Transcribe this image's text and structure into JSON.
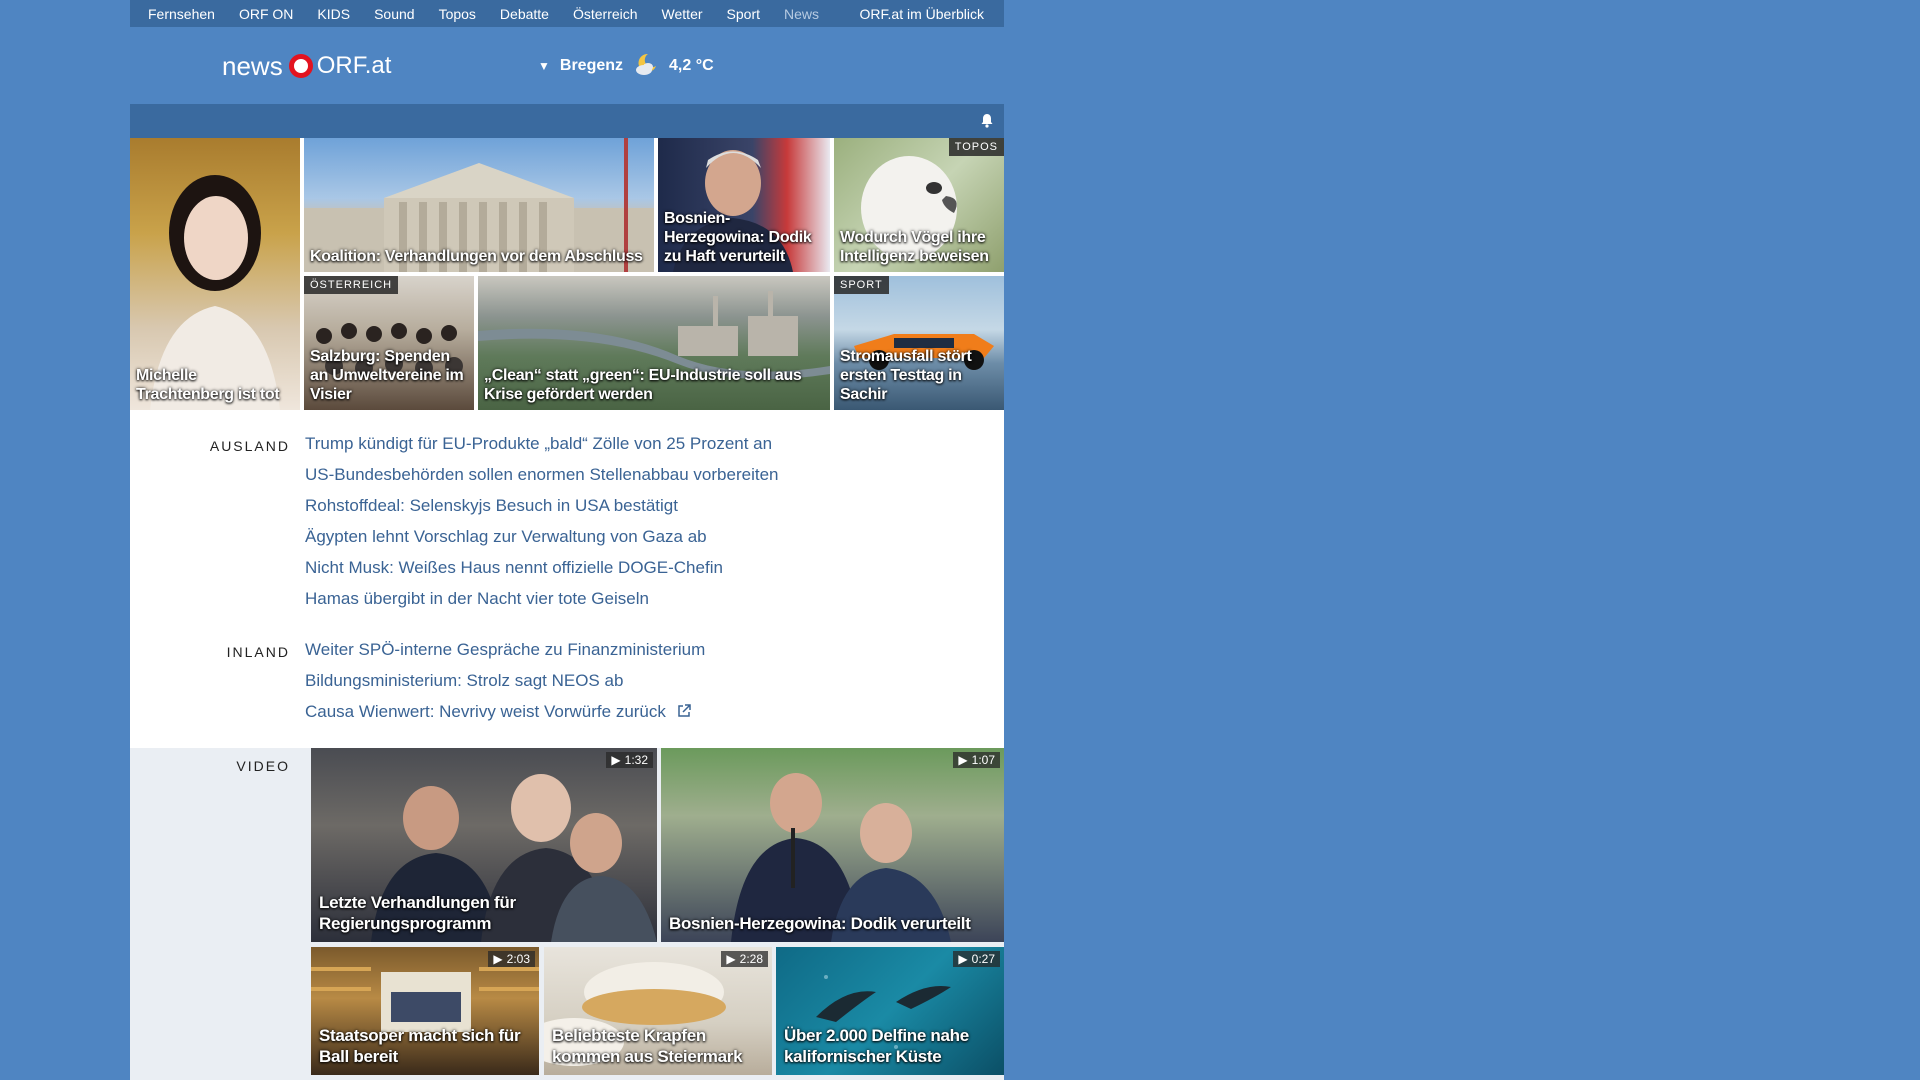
{
  "nav": {
    "items": [
      "Fernsehen",
      "ORF ON",
      "KIDS",
      "Sound",
      "Topos",
      "Debatte",
      "Österreich",
      "Wetter",
      "Sport",
      "News"
    ],
    "active": "News",
    "overview": "ORF.at im Überblick"
  },
  "header": {
    "logo_news": "news",
    "logo_orf": "ORF.at",
    "weather_city": "Bregenz",
    "weather_temp": "4,2 °C",
    "weather_icon": "partly-cloudy-moon-icon"
  },
  "top_stories": [
    {
      "caption": "Michelle Trachtenberg ist tot",
      "tag": ""
    },
    {
      "caption": "Koalition: Verhandlungen vor dem Abschluss",
      "tag": ""
    },
    {
      "caption": "Bosnien-Herzegowina: Dodik zu Haft verurteilt",
      "tag": ""
    },
    {
      "caption": "Wodurch Vögel ihre Intelligenz beweisen",
      "tag": "TOPOS"
    },
    {
      "caption": "Salzburg: Spenden an Umweltvereine im Visier",
      "tag": "ÖSTERREICH"
    },
    {
      "caption": "„Clean“ statt „green“: EU-Industrie soll aus Krise gefördert werden",
      "tag": ""
    },
    {
      "caption": "Stromausfall stört ersten Testtag in Sachir",
      "tag": "SPORT"
    }
  ],
  "ausland": {
    "label": "AUSLAND",
    "items": [
      "Trump kündigt für EU-Produkte „bald“ Zölle von 25 Prozent an",
      "US-Bundesbehörden sollen enormen Stellenabbau vorbereiten",
      "Rohstoffdeal: Selenskyjs Besuch in USA bestätigt",
      "Ägypten lehnt Vorschlag zur Verwaltung von Gaza ab",
      "Nicht Musk: Weißes Haus nennt offizielle DOGE-Chefin",
      "Hamas übergibt in der Nacht vier tote Geiseln"
    ]
  },
  "inland": {
    "label": "INLAND",
    "items": [
      "Weiter SPÖ-interne Gespräche zu Finanzministerium",
      "Bildungsministerium: Strolz sagt NEOS ab",
      "Causa Wienwert: Nevrivy weist Vorwürfe zurück"
    ]
  },
  "video": {
    "label": "VIDEO",
    "items": [
      {
        "caption": "Letzte Verhandlungen für Regierungsprogramm",
        "duration": "1:32"
      },
      {
        "caption": "Bosnien-Herzegowina: Dodik verurteilt",
        "duration": "1:07"
      },
      {
        "caption": "Staatsoper macht sich für Ball bereit",
        "duration": "2:03"
      },
      {
        "caption": "Beliebteste Krapfen kommen aus Steiermark",
        "duration": "2:28"
      },
      {
        "caption": "Über 2.000 Delfine nahe kalifornischer Küste",
        "duration": "0:27"
      }
    ]
  },
  "colors": {
    "page_bg": "#4f85c2",
    "bar_bg": "#3a6a9f",
    "link": "#3a6394",
    "logo_red": "#e3131f"
  }
}
